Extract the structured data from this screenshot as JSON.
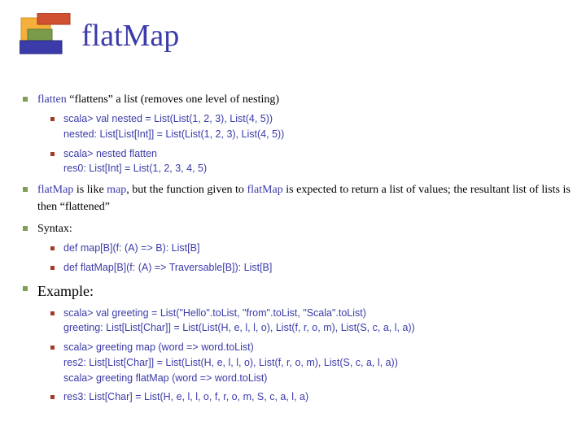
{
  "title": "flatMap",
  "bullets": {
    "b1": {
      "fn": "flatten",
      "rest": " “flattens” a list (removes one level of nesting)"
    },
    "b1s1": {
      "prompt1": "scala>",
      "code1": " val nested = List(List(1, 2, 3), List(4, 5))",
      "out1": "nested: List[List[Int]] = List(List(1, 2, 3), List(4, 5))"
    },
    "b1s2": {
      "prompt1": "scala>",
      "code1": " nested flatten",
      "out1": "res0: List[Int] = List(1, 2, 3, 4, 5)"
    },
    "b2": {
      "fn1": "flatMap",
      "t1": " is like ",
      "fn2": "map",
      "t2": ", but the function given to ",
      "fn3": "flatMap",
      "t3": " is expected to return a list of values; the resultant list of lists is then “flattened”"
    },
    "b3": "Syntax:",
    "b3s1": "def   map[B](f: (A) => B): List[B]",
    "b3s2": "def   flatMap[B](f: (A) => Traversable[B]): List[B]",
    "b4": "Example:",
    "b4s1": {
      "prompt1": "scala>",
      "code1": " val greeting =  List(\"Hello\".toList, \"from\".toList, \"Scala\".toList)",
      "out1": "greeting: List[List[Char]] = List(List(H, e, l, l, o), List(f, r, o, m), List(S, c, a, l, a))"
    },
    "b4s2": {
      "prompt1": "scala>",
      "code1": " greeting map (word => word.toList)",
      "out1": "res2: List[List[Char]] = List(List(H, e, l, l, o), List(f, r, o, m), List(S, c, a, l, a))",
      "prompt2": "scala>",
      "code2": " greeting flatMap (word => word.toList)"
    },
    "b4s3": "res3: List[Char] = List(H, e, l, l, o, f, r, o, m, S, c, a, l, a)"
  }
}
